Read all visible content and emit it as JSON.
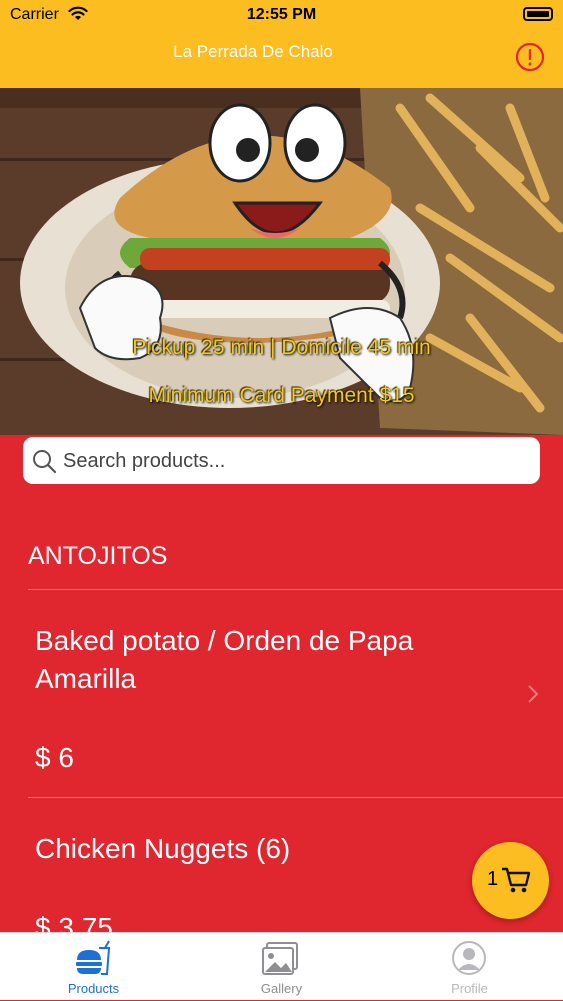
{
  "status_bar": {
    "carrier": "Carrier",
    "time": "12:55 PM"
  },
  "nav": {
    "title": "La Perrada De Chalo",
    "alert_icon": "exclamation-circle-icon"
  },
  "hero": {
    "line1": "Pickup 25 min | Domicile 45 min",
    "line2": "Minimum Card Payment $15"
  },
  "search": {
    "placeholder": "Search products..."
  },
  "section": {
    "title": "ANTOJITOS"
  },
  "items": [
    {
      "name": "Baked potato / Orden de Papa Amarilla",
      "price": "$ 6"
    },
    {
      "name": "Chicken Nuggets (6)",
      "price": "$ 3.75"
    }
  ],
  "cart": {
    "count": "1"
  },
  "tabs": [
    {
      "label": "Products",
      "active": true
    },
    {
      "label": "Gallery",
      "active": false
    },
    {
      "label": "Profile",
      "active": false
    }
  ],
  "colors": {
    "brand_yellow": "#fbbd1f",
    "brand_red": "#e0262e",
    "tab_active": "#1f6fd6",
    "tab_inactive": "#8e8e93"
  }
}
